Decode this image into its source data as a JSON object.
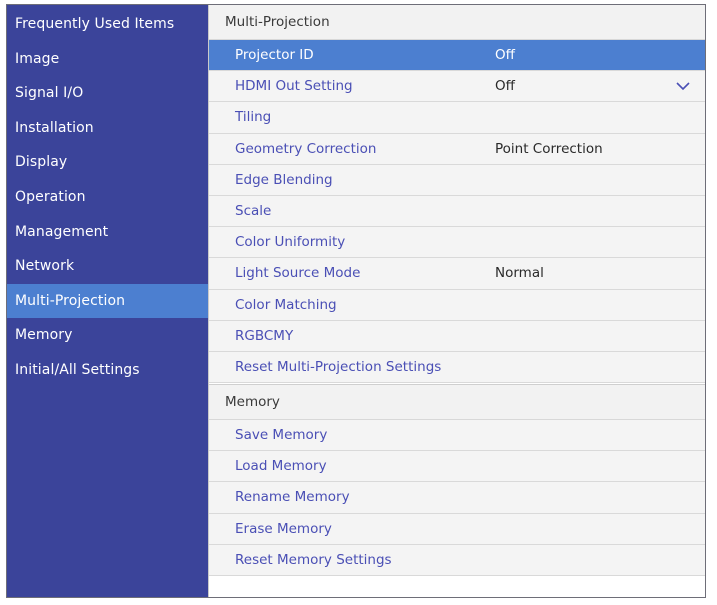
{
  "sidebar": {
    "items": [
      {
        "label": "Frequently Used Items"
      },
      {
        "label": "Image"
      },
      {
        "label": "Signal I/O"
      },
      {
        "label": "Installation"
      },
      {
        "label": "Display"
      },
      {
        "label": "Operation"
      },
      {
        "label": "Management"
      },
      {
        "label": "Network"
      },
      {
        "label": "Multi-Projection",
        "selected": true
      },
      {
        "label": "Memory"
      },
      {
        "label": "Initial/All Settings"
      }
    ]
  },
  "main": {
    "multi_projection": {
      "header": "Multi-Projection",
      "rows": [
        {
          "label": "Projector ID",
          "value": "Off",
          "selected": true
        },
        {
          "label": "HDMI Out Setting",
          "value": "Off",
          "icon": "chevron-down-icon"
        },
        {
          "label": "Tiling",
          "value": ""
        },
        {
          "label": "Geometry Correction",
          "value": "Point Correction"
        },
        {
          "label": "Edge Blending",
          "value": ""
        },
        {
          "label": "Scale",
          "value": ""
        },
        {
          "label": "Color Uniformity",
          "value": ""
        },
        {
          "label": "Light Source Mode",
          "value": "Normal"
        },
        {
          "label": "Color Matching",
          "value": ""
        },
        {
          "label": "RGBCMY",
          "value": ""
        },
        {
          "label": "Reset Multi-Projection Settings",
          "value": ""
        }
      ]
    },
    "memory": {
      "header": "Memory",
      "rows": [
        {
          "label": "Save Memory"
        },
        {
          "label": "Load Memory"
        },
        {
          "label": "Rename Memory"
        },
        {
          "label": "Erase Memory"
        },
        {
          "label": "Reset Memory Settings"
        }
      ]
    }
  },
  "colors": {
    "sidebar_bg": "#3b449a",
    "selected_bg": "#4c7fd0",
    "item_text": "#4a4fb5"
  }
}
